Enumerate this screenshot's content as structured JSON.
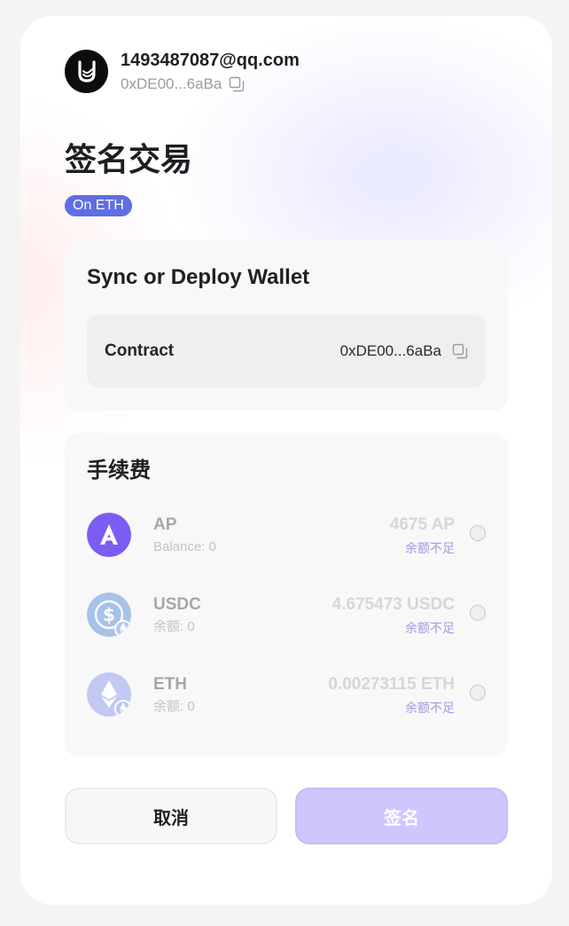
{
  "account": {
    "email": "1493487087@qq.com",
    "address": "0xDE00...6aBa"
  },
  "page": {
    "title": "签名交易",
    "chain_badge": "On ETH"
  },
  "deploy_section": {
    "title": "Sync or Deploy Wallet",
    "contract_label": "Contract",
    "contract_value": "0xDE00...6aBa"
  },
  "fee_section": {
    "title": "手续费",
    "options": [
      {
        "name": "AP",
        "balance": "Balance: 0",
        "amount": "4675 AP",
        "status": "余额不足",
        "icon": "ap-token-icon",
        "color": "#7b5cf5"
      },
      {
        "name": "USDC",
        "balance": "余额: 0",
        "amount": "4.675473 USDC",
        "status": "余额不足",
        "icon": "usdc-token-icon",
        "color": "#a6c3e8"
      },
      {
        "name": "ETH",
        "balance": "余额: 0",
        "amount": "0.00273115 ETH",
        "status": "余额不足",
        "icon": "eth-token-icon",
        "color": "#c2c9f2"
      }
    ]
  },
  "actions": {
    "cancel_label": "取消",
    "sign_label": "签名"
  },
  "colors": {
    "badge": "#5f6ee3",
    "sign_button": "#cec6fc",
    "status_text": "#a997e2"
  }
}
